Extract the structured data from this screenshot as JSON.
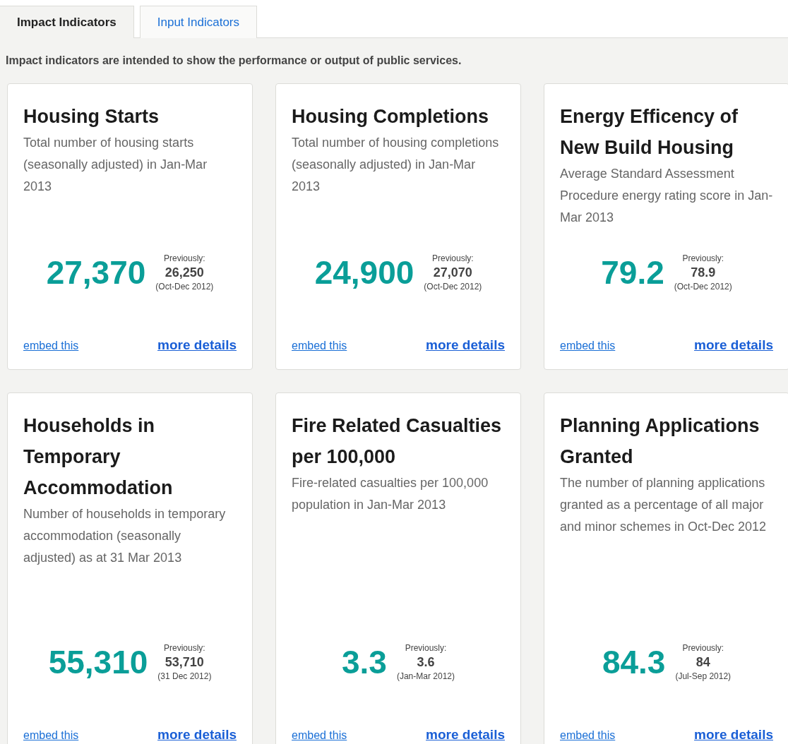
{
  "tabs": [
    {
      "label": "Impact Indicators",
      "selected": true
    },
    {
      "label": "Input Indicators",
      "selected": false
    }
  ],
  "intro": "Impact indicators are intended to show the performance or output of public services.",
  "indicators": [
    {
      "title": "Housing Starts",
      "description": "Total number of housing starts (seasonally adjusted) in Jan-Mar 2013",
      "value": "27,370",
      "previous_label": "Previously:",
      "previous_value": "26,250",
      "previous_period": "(Oct-Dec 2012)",
      "embed_link": "embed this",
      "details_link": "more details"
    },
    {
      "title": "Housing Completions",
      "description": "Total number of housing completions (seasonally adjusted) in Jan-Mar 2013",
      "value": "24,900",
      "previous_label": "Previously:",
      "previous_value": "27,070",
      "previous_period": "(Oct-Dec 2012)",
      "embed_link": "embed this",
      "details_link": "more details"
    },
    {
      "title": "Energy Efficency of New Build Housing",
      "description": "Average Standard Assessment Procedure energy rating score in Jan-Mar 2013",
      "value": "79.2",
      "previous_label": "Previously:",
      "previous_value": "78.9",
      "previous_period": "(Oct-Dec 2012)",
      "embed_link": "embed this",
      "details_link": "more details"
    },
    {
      "title": "Households in Temporary Accommodation",
      "description": "Number of households in temporary accommodation (seasonally adjusted) as at 31 Mar 2013",
      "value": "55,310",
      "previous_label": "Previously:",
      "previous_value": "53,710",
      "previous_period": "(31 Dec 2012)",
      "embed_link": "embed this",
      "details_link": "more details"
    },
    {
      "title": "Fire Related Casualties per 100,000",
      "description": "Fire-related casualties per 100,000 population in Jan-Mar 2013",
      "value": "3.3",
      "previous_label": "Previously:",
      "previous_value": "3.6",
      "previous_period": "(Jan-Mar 2012)",
      "embed_link": "embed this",
      "details_link": "more details"
    },
    {
      "title": "Planning Applications Granted",
      "description": "The number of planning applications granted as a percentage of all major and minor schemes in Oct-Dec 2012",
      "value": "84.3",
      "previous_label": "Previously:",
      "previous_value": "84",
      "previous_period": "(Jul-Sep 2012)",
      "embed_link": "embed this",
      "details_link": "more details"
    }
  ]
}
